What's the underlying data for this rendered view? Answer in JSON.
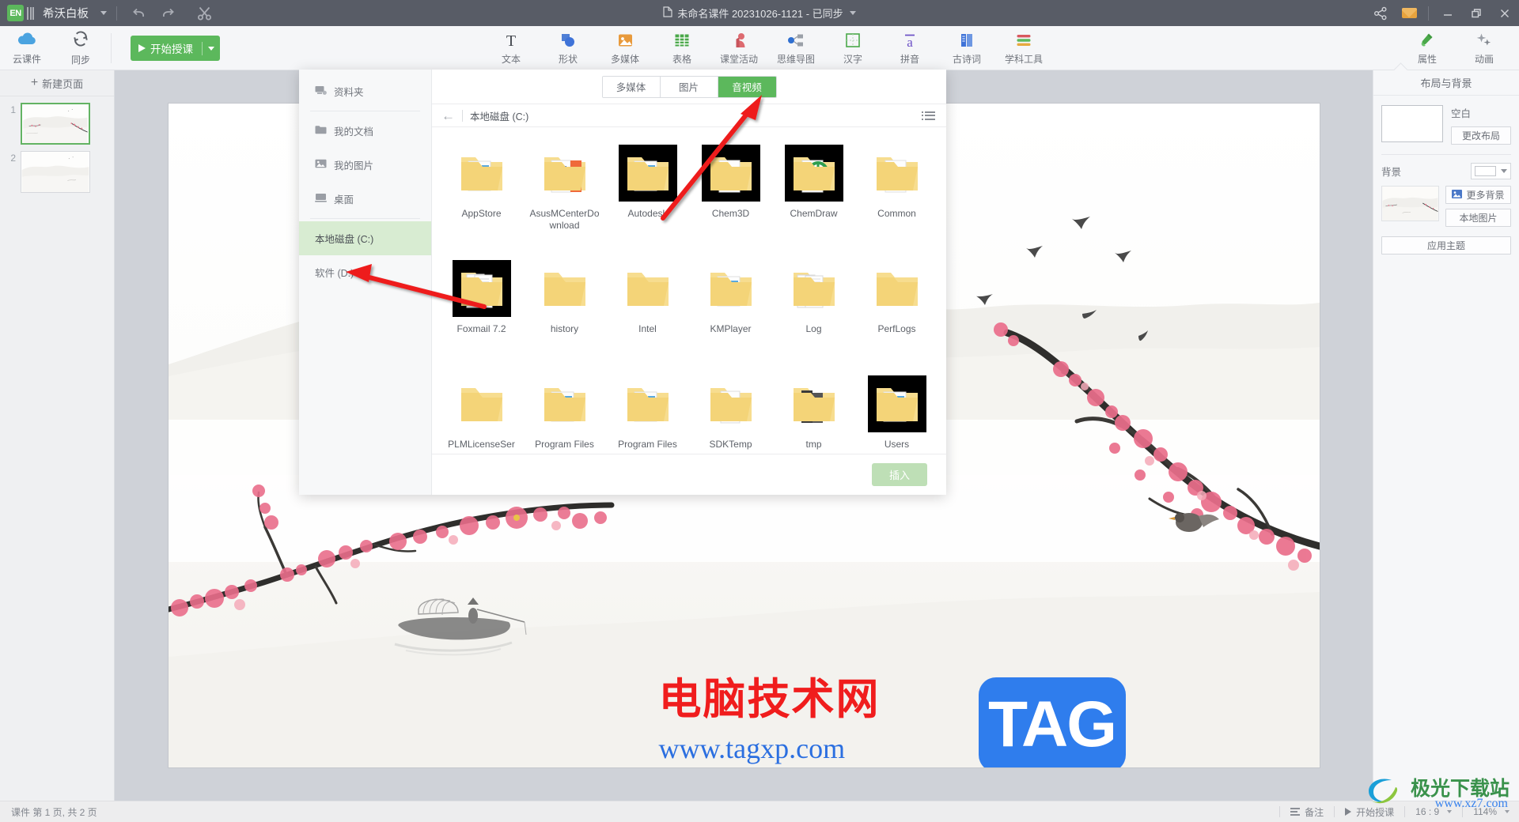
{
  "titlebar": {
    "brand": "希沃白板",
    "logo_text": "EN",
    "document_title": "未命名课件 20231026-1121 - 已同步",
    "doc_icon": "document-icon",
    "undo_icon": "undo-icon",
    "redo_icon": "redo-icon",
    "cut_icon": "scissors-icon",
    "share_icon": "share-icon",
    "mail_icon": "envelope-icon",
    "minimize": "—",
    "restore": "❐",
    "close": "✕"
  },
  "ribbon": {
    "left_buttons": [
      {
        "label": "云课件",
        "icon": "cloud-icon"
      },
      {
        "label": "同步",
        "icon": "sync-icon"
      }
    ],
    "start_class": "开始授课",
    "tools": [
      {
        "label": "文本",
        "icon": "text-icon"
      },
      {
        "label": "形状",
        "icon": "shapes-icon"
      },
      {
        "label": "多媒体",
        "icon": "media-icon"
      },
      {
        "label": "表格",
        "icon": "table-icon"
      },
      {
        "label": "课堂活动",
        "icon": "classroom-activity-icon"
      },
      {
        "label": "思维导图",
        "icon": "mindmap-icon"
      },
      {
        "label": "汉字",
        "icon": "hanzi-icon"
      },
      {
        "label": "拼音",
        "icon": "pinyin-icon"
      },
      {
        "label": "古诗词",
        "icon": "poetry-icon"
      },
      {
        "label": "学科工具",
        "icon": "subject-tools-icon"
      }
    ],
    "right_tools": [
      {
        "label": "属性",
        "icon": "paint-bottle-icon"
      },
      {
        "label": "动画",
        "icon": "stars-icon"
      }
    ]
  },
  "slide_panel": {
    "new_page": "新建页面",
    "slides": [
      {
        "number": "1",
        "selected": true
      },
      {
        "number": "2",
        "selected": false
      }
    ]
  },
  "right_panel": {
    "title": "布局与背景",
    "layout_name": "空白",
    "change_layout": "更改布局",
    "background_label": "背景",
    "more_background": "更多背景",
    "local_image": "本地图片",
    "apply_theme": "应用主题",
    "image_icon": "picture-icon",
    "swatch_color": "#ffffff"
  },
  "dialog": {
    "sidebar": [
      {
        "label": "资料夹",
        "icon": "resource-folder-icon",
        "active": false,
        "divider_after": true
      },
      {
        "label": "我的文档",
        "icon": "folder-icon",
        "active": false,
        "divider_after": false
      },
      {
        "label": "我的图片",
        "icon": "picture-icon",
        "active": false,
        "divider_after": false
      },
      {
        "label": "桌面",
        "icon": "desktop-icon",
        "active": false,
        "divider_after": true
      },
      {
        "label": "本地磁盘 (C:)",
        "icon": "",
        "active": true,
        "divider_after": false
      },
      {
        "label": "软件 (D:)",
        "icon": "",
        "active": false,
        "divider_after": false
      }
    ],
    "tabs": [
      {
        "label": "多媒体",
        "active": false
      },
      {
        "label": "图片",
        "active": false
      },
      {
        "label": "音视频",
        "active": true
      }
    ],
    "back_icon": "back-arrow-icon",
    "path": "本地磁盘 (C:)",
    "view_icon": "list-view-icon",
    "insert_button": "插入",
    "files": [
      {
        "name": "AppStore",
        "style": "docs",
        "dark": false
      },
      {
        "name": "AsusMCenterDownload",
        "style": "asus",
        "dark": false
      },
      {
        "name": "Autodesk",
        "style": "docs",
        "dark": true
      },
      {
        "name": "Chem3D",
        "style": "color-wheel",
        "dark": true
      },
      {
        "name": "ChemDraw",
        "style": "gear-green",
        "dark": true
      },
      {
        "name": "Common",
        "style": "paper",
        "dark": false
      },
      {
        "name": "Foxmail 7.2",
        "style": "papers",
        "dark": true
      },
      {
        "name": "history",
        "style": "plain",
        "dark": false
      },
      {
        "name": "Intel",
        "style": "plain",
        "dark": false
      },
      {
        "name": "KMPlayer",
        "style": "docs",
        "dark": false
      },
      {
        "name": "Log",
        "style": "lined",
        "dark": false
      },
      {
        "name": "PerfLogs",
        "style": "plain",
        "dark": false
      },
      {
        "name": "PLMLicenseSer",
        "style": "plain",
        "dark": false
      },
      {
        "name": "Program Files",
        "style": "docs",
        "dark": false
      },
      {
        "name": "Program Files",
        "style": "docs",
        "dark": false
      },
      {
        "name": "SDKTemp",
        "style": "gear-gray",
        "dark": false
      },
      {
        "name": "tmp",
        "style": "black-doc",
        "dark": false
      },
      {
        "name": "Users",
        "style": "docs",
        "dark": true
      }
    ]
  },
  "statusbar": {
    "page_info": "课件 第 1 页, 共 2 页",
    "notes": "备注",
    "start_class": "开始授课",
    "ratio": "16 : 9",
    "zoom": "114%"
  },
  "watermark": {
    "cn_text": "电脑技术网",
    "url": "www.tagxp.com",
    "tag": "TAG",
    "cn_color": "#f01d1d",
    "url_color": "#2b6fe0",
    "tag_bg": "#2f7ded"
  },
  "site_logo": {
    "name": "极光下载站",
    "url": "www.xz7.com"
  },
  "annotations": {
    "arrow_color": "#ee1c1c",
    "arrow1_target": "音视频",
    "arrow2_target": "软件 (D:)"
  }
}
